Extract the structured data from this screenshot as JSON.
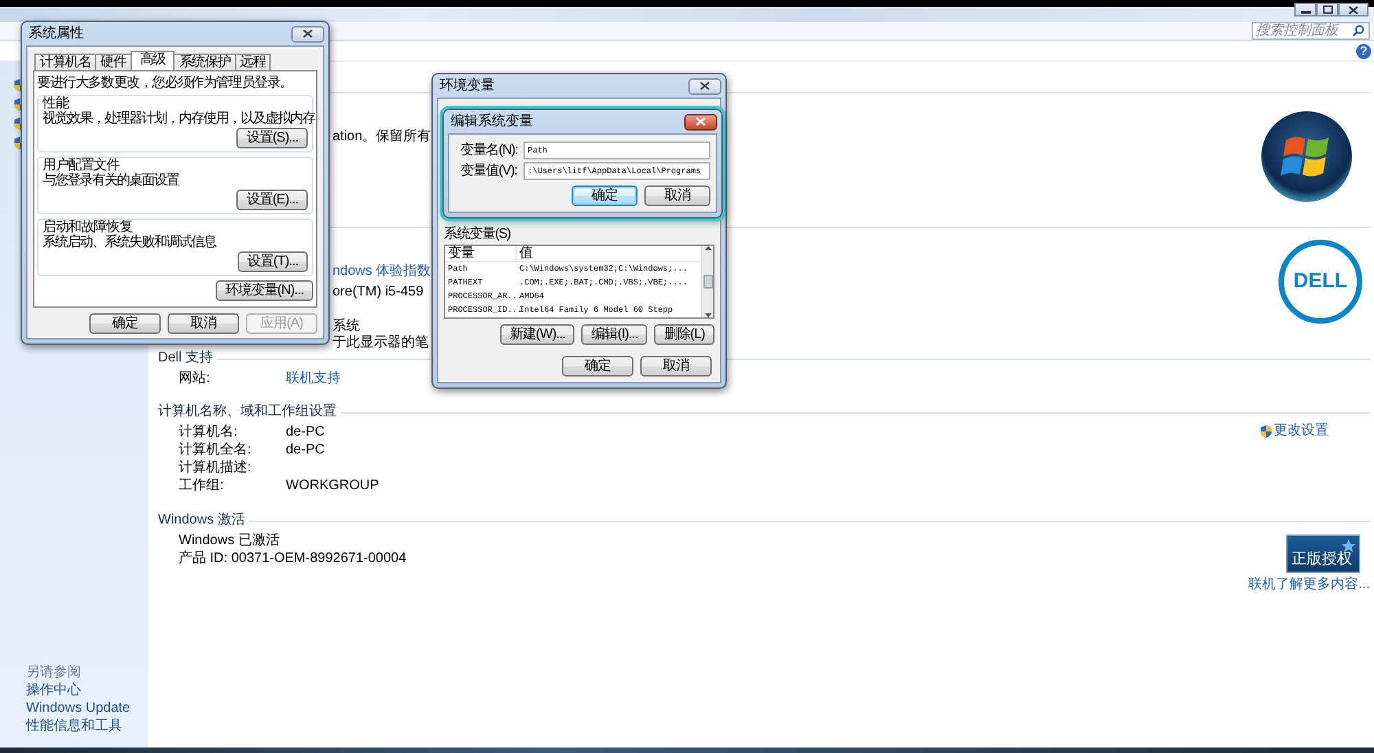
{
  "control_panel": {
    "search": {
      "placeholder": "搜索控制面板"
    },
    "help_glyph": "?",
    "sidebar": {
      "see_also_title": "另请参阅",
      "see_also_links": [
        "操作中心",
        "Windows Update",
        "性能信息和工具"
      ]
    },
    "covered_sections": [
      {
        "fragments": [
          {
            "text": "ation。保留所有",
            "kind": "text"
          }
        ]
      },
      {
        "fragments": [
          {
            "text": "ndows 体验指数",
            "kind": "link"
          },
          {
            "text": "ore(TM) i5-459",
            "kind": "text"
          },
          {
            "text": "系统",
            "kind": "text"
          },
          {
            "text": "于此显示器的笔",
            "kind": "text"
          }
        ]
      }
    ],
    "logo_text": "DELL",
    "sections": [
      {
        "title": "Dell 支持",
        "rows": [
          {
            "label": "网站:",
            "value": "联机支持",
            "kind": "link"
          }
        ]
      },
      {
        "title": "计算机名称、域和工作组设置",
        "rows": [
          {
            "label": "计算机名:",
            "value": "de-PC",
            "kind": "text"
          },
          {
            "label": "计算机全名:",
            "value": "de-PC",
            "kind": "text"
          },
          {
            "label": "计算机描述:",
            "kind": "text"
          },
          {
            "label": "工作组:",
            "value": "WORKGROUP",
            "kind": "text"
          }
        ],
        "aside_link": "更改设置"
      },
      {
        "title": "Windows 激活",
        "rows": [
          {
            "label": "Windows 已激活",
            "kind": "text"
          },
          {
            "label": "产品 ID: 00371-OEM-8992671-00004",
            "kind": "text"
          }
        ],
        "badge": "正版授权",
        "aside_link": "联机了解更多内容..."
      }
    ]
  },
  "system_properties": {
    "title": "系统属性",
    "tabs": [
      {
        "label": "计算机名",
        "selected": false
      },
      {
        "label": "硬件",
        "selected": false
      },
      {
        "label": "高级",
        "selected": true
      },
      {
        "label": "系统保护",
        "selected": false
      },
      {
        "label": "远程",
        "selected": false
      }
    ],
    "notice": "要进行大多数更改，您必须作为管理员登录。",
    "groups": [
      {
        "title": "性能",
        "description": "视觉效果，处理器计划，内存使用，以及虚拟内存",
        "button": "设置(S)..."
      },
      {
        "title": "用户配置文件",
        "description": "与您登录有关的桌面设置",
        "button": "设置(E)..."
      },
      {
        "title": "启动和故障恢复",
        "description": "系统启动、系统失败和调试信息",
        "button": "设置(T)..."
      }
    ],
    "env_button": "环境变量(N)...",
    "buttons": [
      {
        "label": "确定",
        "disabled": false
      },
      {
        "label": "取消",
        "disabled": false
      },
      {
        "label": "应用(A)",
        "disabled": true
      }
    ]
  },
  "environment_variables": {
    "title": "环境变量",
    "system_vars_label": "系统变量(S)",
    "table": {
      "columns": [
        "变量",
        "值"
      ],
      "rows": [
        [
          "Path",
          "C:\\Windows\\system32;C:\\Windows;..."
        ],
        [
          "PATHEXT",
          ".COM;.EXE;.BAT;.CMD;.VBS;.VBE;...."
        ],
        [
          "PROCESSOR_AR...",
          "AMD64"
        ],
        [
          "PROCESSOR_ID...",
          "Intel64 Family 6 Model 60 Stepp"
        ]
      ]
    },
    "table_buttons": [
      "新建(W)...",
      "编辑(I)...",
      "删除(L)"
    ],
    "buttons": [
      "确定",
      "取消"
    ]
  },
  "edit_variable": {
    "title": "编辑系统变量",
    "fields": [
      {
        "label": "变量名(N):",
        "value": "Path"
      },
      {
        "label": "变量值(V):",
        "value": ":\\Users\\litf\\AppData\\Local\\Programs"
      }
    ],
    "buttons": [
      {
        "label": "确定",
        "default": true
      },
      {
        "label": "取消",
        "default": false
      }
    ]
  }
}
